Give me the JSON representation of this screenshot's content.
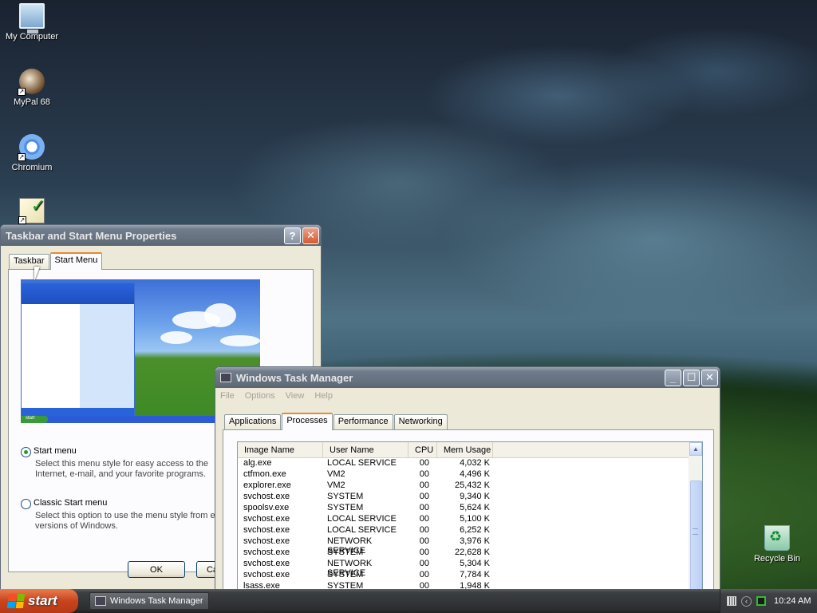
{
  "desktop": {
    "icons": [
      {
        "label": "My Computer",
        "icon": "computer-icon"
      },
      {
        "label": "MyPal 68",
        "icon": "mypal-icon"
      },
      {
        "label": "Chromium",
        "icon": "chromium-icon"
      },
      {
        "label": "",
        "icon": "app-shortcut-icon"
      },
      {
        "label": "Recycle Bin",
        "icon": "recycle-bin-icon"
      }
    ]
  },
  "taskbar_props": {
    "title": "Taskbar and Start Menu Properties",
    "help_glyph": "?",
    "close_glyph": "✕",
    "tabs": [
      {
        "label": "Taskbar"
      },
      {
        "label": "Start Menu"
      }
    ],
    "options": [
      {
        "label": "Start menu",
        "description": "Select this menu style for easy access to the Internet, e-mail, and your favorite programs.",
        "checked": true
      },
      {
        "label": "Classic Start menu",
        "description": "Select this option to use the menu style from earlier versions of Windows.",
        "checked": false
      }
    ],
    "ok_label": "OK",
    "cancel_label": "Ca"
  },
  "task_manager": {
    "title": "Windows Task Manager",
    "minimize_glyph": "_",
    "maximize_glyph": "☐",
    "close_glyph": "✕",
    "menu": [
      "File",
      "Options",
      "View",
      "Help"
    ],
    "tabs": [
      "Applications",
      "Processes",
      "Performance",
      "Networking"
    ],
    "active_tab": "Processes",
    "columns": [
      "Image Name",
      "User Name",
      "CPU",
      "Mem Usage"
    ],
    "processes": [
      {
        "name": "alg.exe",
        "user": "LOCAL SERVICE",
        "cpu": "00",
        "mem": "4,032 K"
      },
      {
        "name": "ctfmon.exe",
        "user": "VM2",
        "cpu": "00",
        "mem": "4,496 K"
      },
      {
        "name": "explorer.exe",
        "user": "VM2",
        "cpu": "00",
        "mem": "25,432 K"
      },
      {
        "name": "svchost.exe",
        "user": "SYSTEM",
        "cpu": "00",
        "mem": "9,340 K"
      },
      {
        "name": "spoolsv.exe",
        "user": "SYSTEM",
        "cpu": "00",
        "mem": "5,624 K"
      },
      {
        "name": "svchost.exe",
        "user": "LOCAL SERVICE",
        "cpu": "00",
        "mem": "5,100 K"
      },
      {
        "name": "svchost.exe",
        "user": "LOCAL SERVICE",
        "cpu": "00",
        "mem": "6,252 K"
      },
      {
        "name": "svchost.exe",
        "user": "NETWORK SERVICE",
        "cpu": "00",
        "mem": "3,976 K"
      },
      {
        "name": "svchost.exe",
        "user": "SYSTEM",
        "cpu": "00",
        "mem": "22,628 K"
      },
      {
        "name": "svchost.exe",
        "user": "NETWORK SERVICE",
        "cpu": "00",
        "mem": "5,304 K"
      },
      {
        "name": "svchost.exe",
        "user": "SYSTEM",
        "cpu": "00",
        "mem": "7,784 K"
      },
      {
        "name": "lsass.exe",
        "user": "SYSTEM",
        "cpu": "00",
        "mem": "1,948 K"
      }
    ]
  },
  "taskbar": {
    "start_label": "start",
    "task_button_label": "Windows Task Manager",
    "clock": "10:24 AM",
    "tray_chevron": "‹"
  },
  "colors": {
    "start_button": "#c9431c",
    "active_tab_accent": "#e68b2c",
    "radio_checked": "#21a121"
  }
}
